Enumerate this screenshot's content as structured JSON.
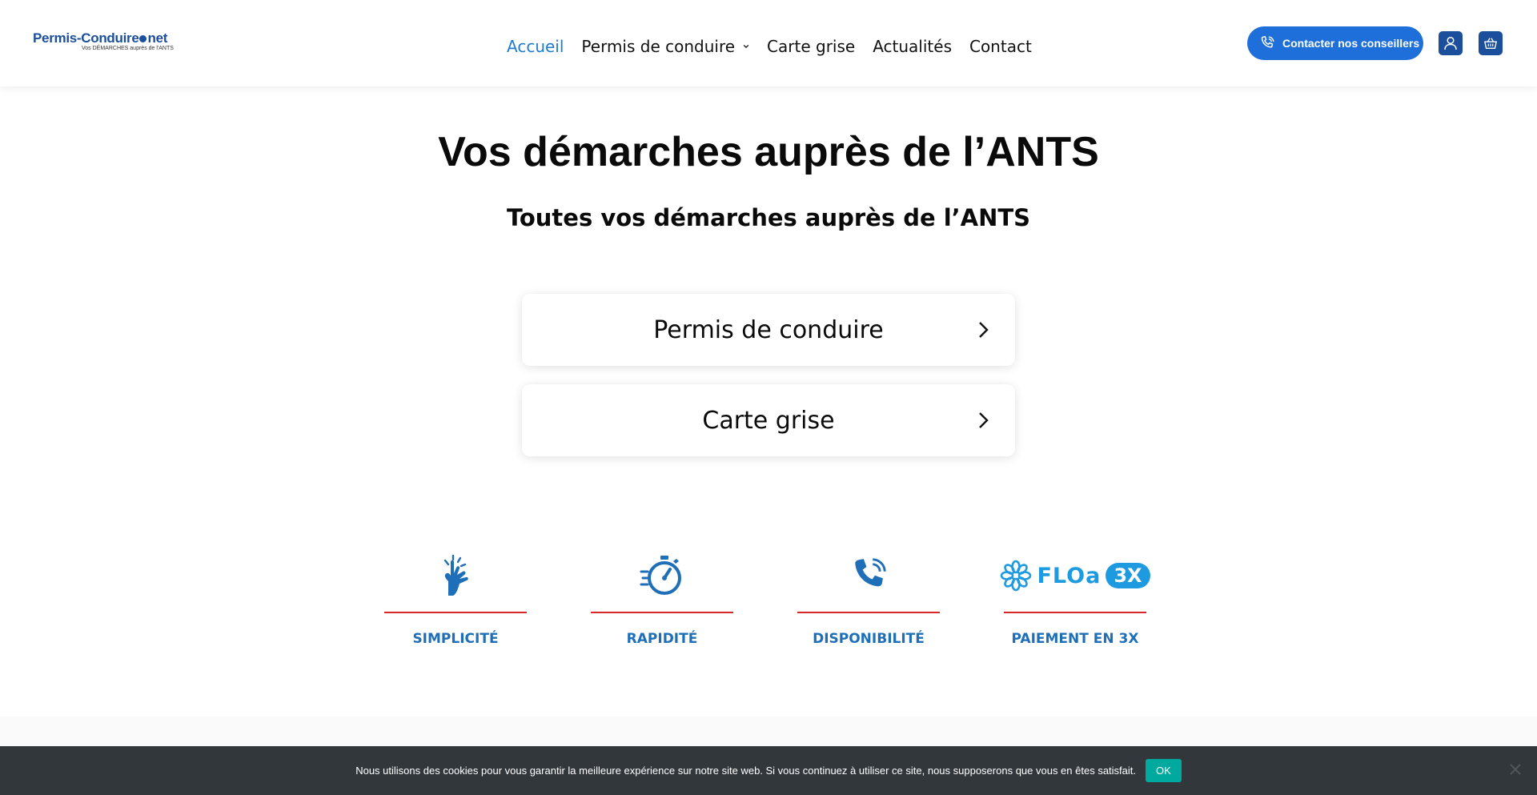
{
  "header": {
    "logo": {
      "main_left": "Permis-Conduire",
      "main_right": "net",
      "tagline": "Vos DÉMARCHES auprès de l'ANTS"
    },
    "nav": [
      {
        "label": "Accueil",
        "active": true
      },
      {
        "label": "Permis de conduire",
        "dropdown": true
      },
      {
        "label": "Carte grise"
      },
      {
        "label": "Actualités"
      },
      {
        "label": "Contact"
      }
    ],
    "contact_button": "Contacter nos conseillers"
  },
  "hero": {
    "title": "Vos démarches auprès de l’ANTS",
    "subtitle": "Toutes vos démarches auprès de l’ANTS"
  },
  "cards": [
    {
      "label": "Permis de conduire"
    },
    {
      "label": "Carte grise"
    }
  ],
  "features": [
    {
      "label": "SIMPLICITÉ",
      "icon": "finger-tap-icon"
    },
    {
      "label": "RAPIDITÉ",
      "icon": "stopwatch-icon"
    },
    {
      "label": "DISPONIBILITÉ",
      "icon": "phone-ringing-icon"
    },
    {
      "label": "PAIEMENT EN 3X",
      "icon": "floa-3x-logo",
      "logo_text": "FLOa",
      "badge_text": "3X"
    }
  ],
  "cookie": {
    "text": "Nous utilisons des cookies pour vous garantir la meilleure expérience sur notre site web. Si vous continuez à utiliser ce site, nous supposerons que vous en êtes satisfait.",
    "ok": "OK"
  },
  "colors": {
    "brand_blue": "#1b4f9c",
    "accent_blue": "#1e6fd9",
    "feature_red": "#d62828",
    "cookie_bg": "#32373c",
    "cookie_ok": "#00a99d"
  }
}
